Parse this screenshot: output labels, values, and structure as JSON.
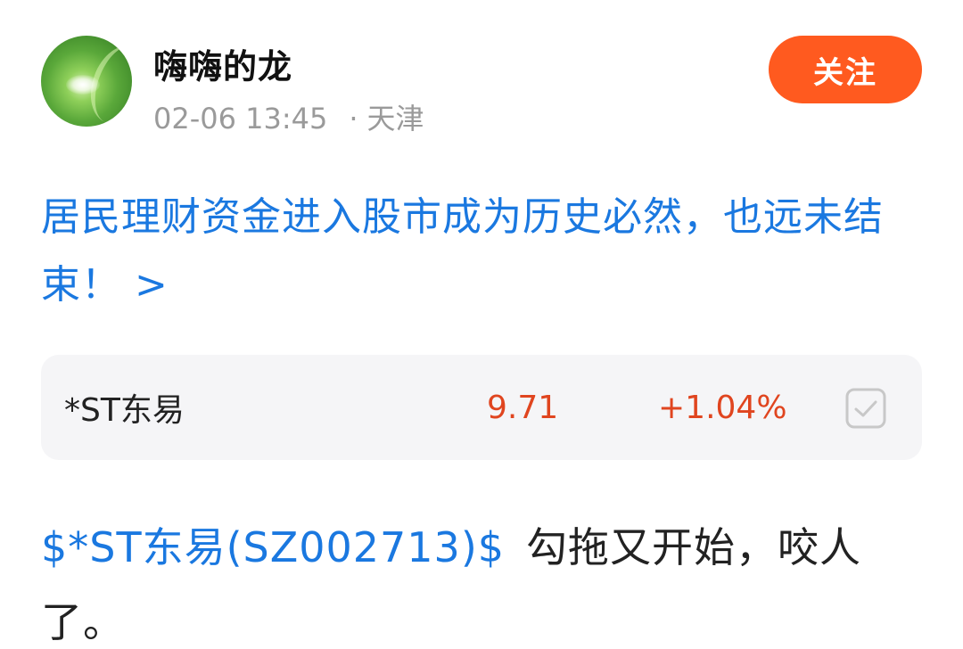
{
  "author": {
    "name": "嗨嗨的龙",
    "time": "02-06 13:45",
    "separator": "·",
    "location": "天津"
  },
  "follow_button": {
    "label": "关注",
    "color": "#ff5a1f"
  },
  "topic": {
    "text": "居民理财资金进入股市成为历史必然，也远未结束！ >"
  },
  "stock_card": {
    "name": "*ST东易",
    "price": "9.71",
    "change": "+1.04%",
    "change_color": "#e0451f",
    "check_icon": "checkbox-icon"
  },
  "content": {
    "stock_link": "$*ST东易(SZ002713)$",
    "text": "勾拖又开始，咬人了。"
  }
}
